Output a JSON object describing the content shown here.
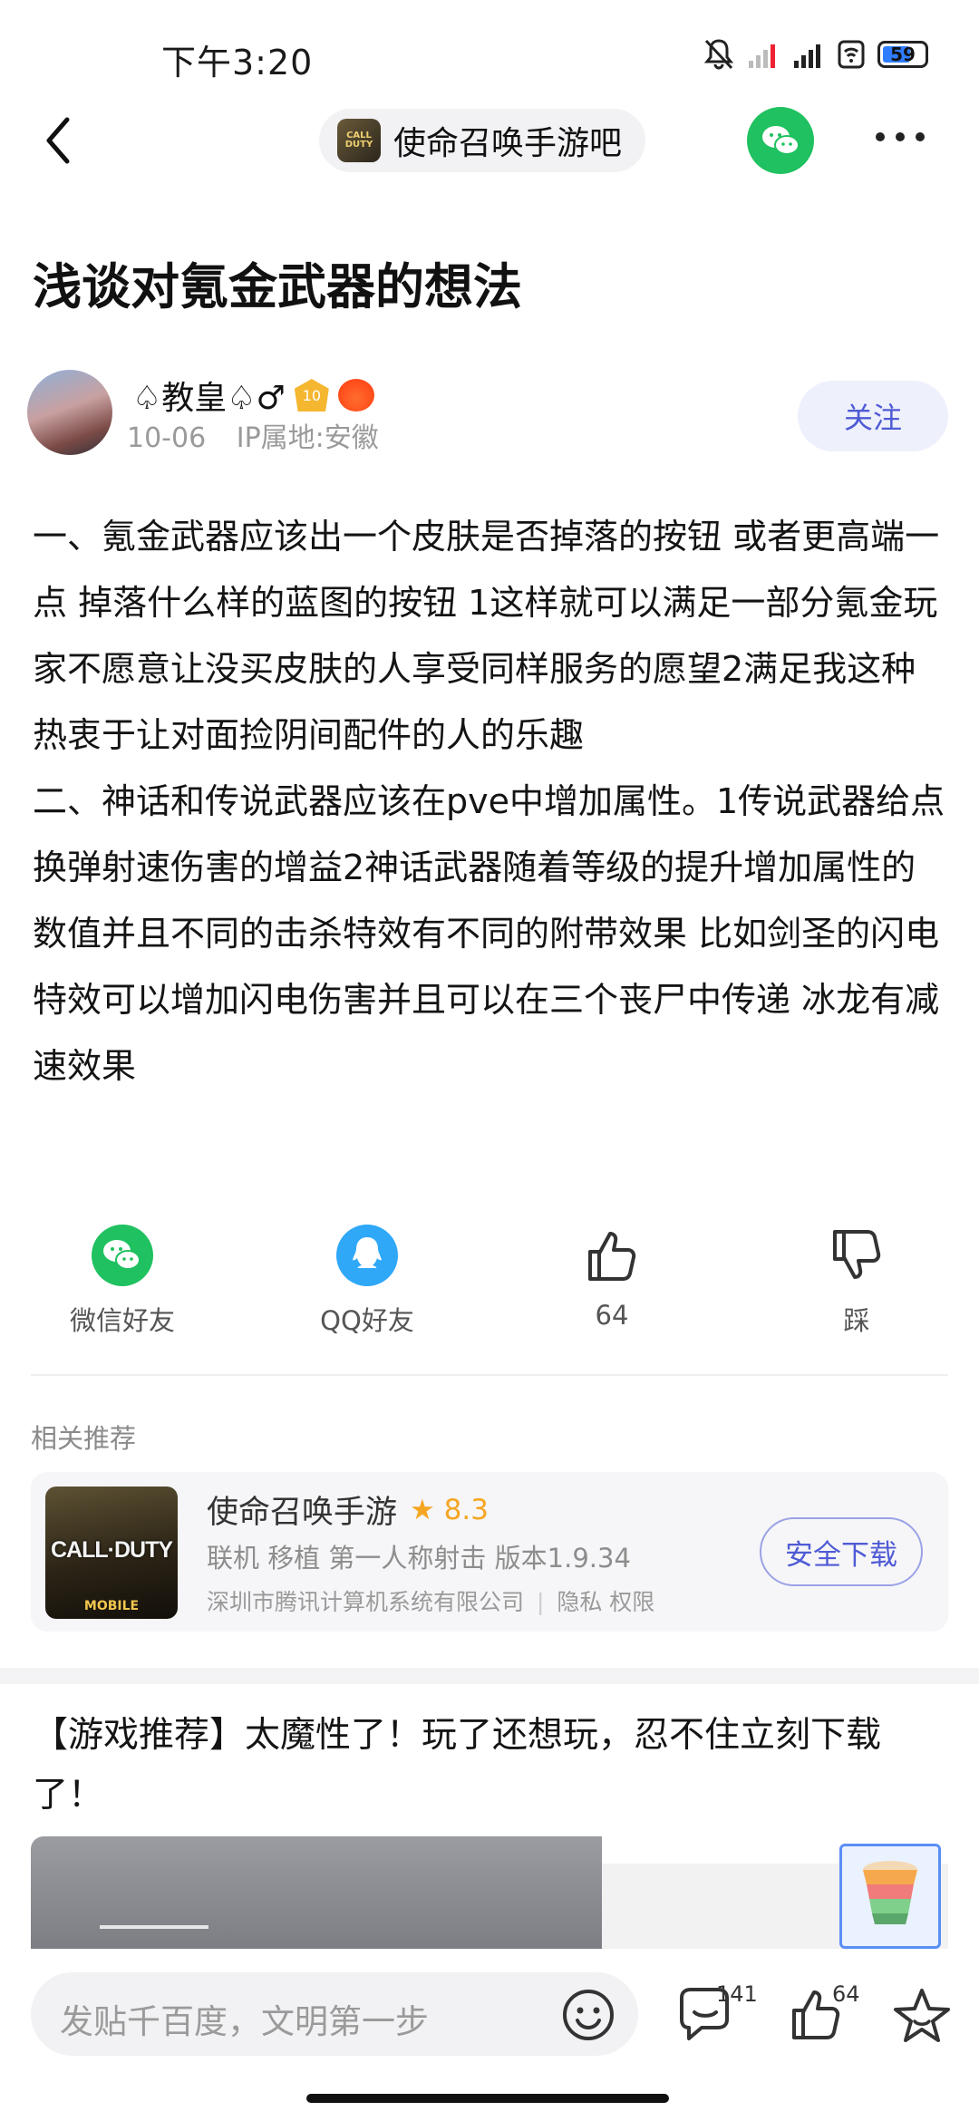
{
  "status_bar": {
    "time": "下午3:20",
    "battery": "59"
  },
  "header": {
    "forum_name": "使命召唤手游吧",
    "forum_logo_text": "CALL DUTY"
  },
  "post": {
    "title": "浅谈对氪金武器的想法",
    "author": {
      "name": "♤教皇♤♂",
      "level": "10",
      "date": "10-06",
      "ip": "IP属地:安徽"
    },
    "follow_label": "关注",
    "content": "一、氪金武器应该出一个皮肤是否掉落的按钮 或者更高端一点 掉落什么样的蓝图的按钮 1这样就可以满足一部分氪金玩家不愿意让没买皮肤的人享受同样服务的愿望2满足我这种热衷于让对面捡阴间配件的人的乐趣\n二、神话和传说武器应该在pve中增加属性。1传说武器给点换弹射速伤害的增益2神话武器随着等级的提升增加属性的数值并且不同的击杀特效有不同的附带效果 比如剑圣的闪电特效可以增加闪电伤害并且可以在三个丧尸中传递 冰龙有减速效果"
  },
  "actions": [
    {
      "icon": "wechat-icon",
      "label": "微信好友"
    },
    {
      "icon": "qq-icon",
      "label": "QQ好友"
    },
    {
      "icon": "thumbs-up-icon",
      "label": "64"
    },
    {
      "icon": "thumbs-down-icon",
      "label": "踩"
    }
  ],
  "related": {
    "heading": "相关推荐",
    "app": {
      "name": "使命召唤手游",
      "rating": "8.3",
      "tags": "联机  移植  第一人称射击   版本1.9.34",
      "developer": "深圳市腾讯计算机系统有限公司",
      "links": "隐私  权限",
      "download_label": "安全下载",
      "icon_text": "CALL·DUTY",
      "icon_sub": "MOBILE"
    }
  },
  "promo": {
    "title": "【游戏推荐】太魔性了！玩了还想玩，忍不住立刻下载了！"
  },
  "bottom_bar": {
    "input_placeholder": "发贴千百度，文明第一步",
    "comment_count": "141",
    "like_count": "64"
  },
  "colors": {
    "accent": "#4f5bd5",
    "wechat": "#1fc160",
    "qq": "#2fa8f8",
    "rating": "#f5a623"
  }
}
